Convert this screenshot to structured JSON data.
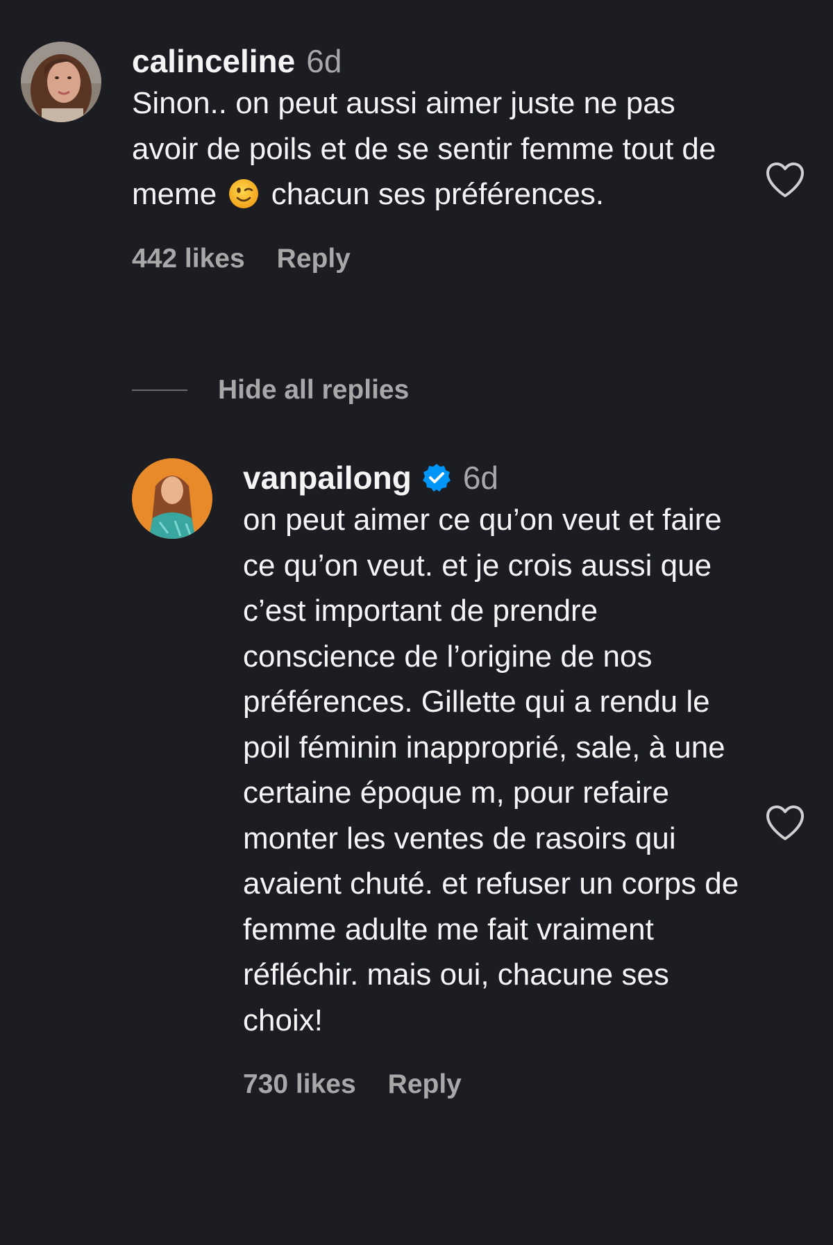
{
  "comments": [
    {
      "username": "calinceline",
      "timestamp": "6d",
      "verified": false,
      "text_before_emoji": "Sinon.. on peut aussi aimer juste ne pas avoir de poils et de se sentir femme tout de meme",
      "emoji": "winking-face",
      "text_after_emoji": "chacun ses préférences.",
      "likes_label": "442 likes",
      "reply_label": "Reply"
    },
    {
      "username": "vanpailong",
      "timestamp": "6d",
      "verified": true,
      "text": "on peut aimer ce qu’on veut et faire ce qu’on veut. et je crois aussi que c’est important de prendre conscience de l’origine de nos préférences. Gillette qui a rendu le poil féminin inapproprié, sale, à une certaine époque m, pour refaire monter les ventes de rasoirs qui avaient chuté. et refuser un corps de femme adulte me fait vraiment réfléchir. mais oui, chacune ses choix!",
      "likes_label": "730 likes",
      "reply_label": "Reply"
    }
  ],
  "replies_toggle_label": "Hide all replies",
  "colors": {
    "background": "#1b1d22",
    "primary_text": "#f5f5f5",
    "secondary_text": "#a8a8a8",
    "verified_badge": "#0095f6"
  }
}
